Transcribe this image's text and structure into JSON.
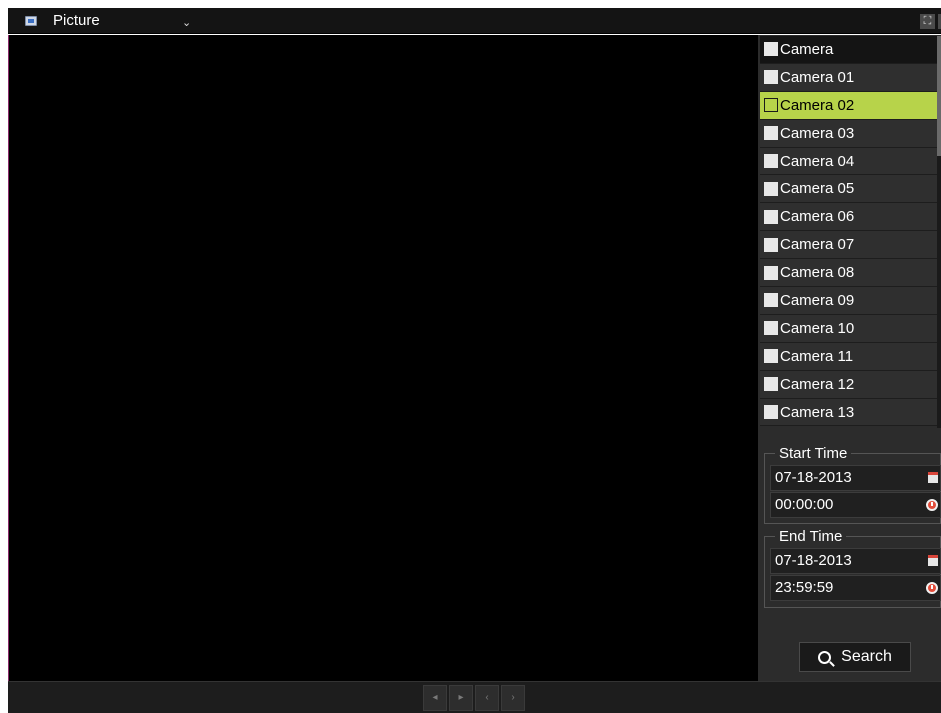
{
  "titlebar": {
    "title": "Picture",
    "chevron": "⌄",
    "fullscreen_icon": "⛶",
    "close_icon": "×"
  },
  "camera_list": {
    "header": "Camera",
    "items": [
      {
        "label": "Camera 01",
        "selected": false
      },
      {
        "label": "Camera 02",
        "selected": true
      },
      {
        "label": "Camera 03",
        "selected": false
      },
      {
        "label": "Camera 04",
        "selected": false
      },
      {
        "label": "Camera 05",
        "selected": false
      },
      {
        "label": "Camera 06",
        "selected": false
      },
      {
        "label": "Camera 07",
        "selected": false
      },
      {
        "label": "Camera 08",
        "selected": false
      },
      {
        "label": "Camera 09",
        "selected": false
      },
      {
        "label": "Camera 10",
        "selected": false
      },
      {
        "label": "Camera 11",
        "selected": false
      },
      {
        "label": "Camera 12",
        "selected": false
      },
      {
        "label": "Camera 13",
        "selected": false
      }
    ]
  },
  "start_time": {
    "legend": "Start Time",
    "date": "07-18-2013",
    "time": "00:00:00"
  },
  "end_time": {
    "legend": "End Time",
    "date": "07-18-2013",
    "time": "23:59:59"
  },
  "search": {
    "label": "Search"
  },
  "pager": {
    "buttons": [
      "◂",
      "▸",
      "‹",
      "›"
    ]
  },
  "colors": {
    "selected_row": "#b7d34a",
    "panel_bg": "#2c2c2c",
    "video_bg": "#000000"
  }
}
